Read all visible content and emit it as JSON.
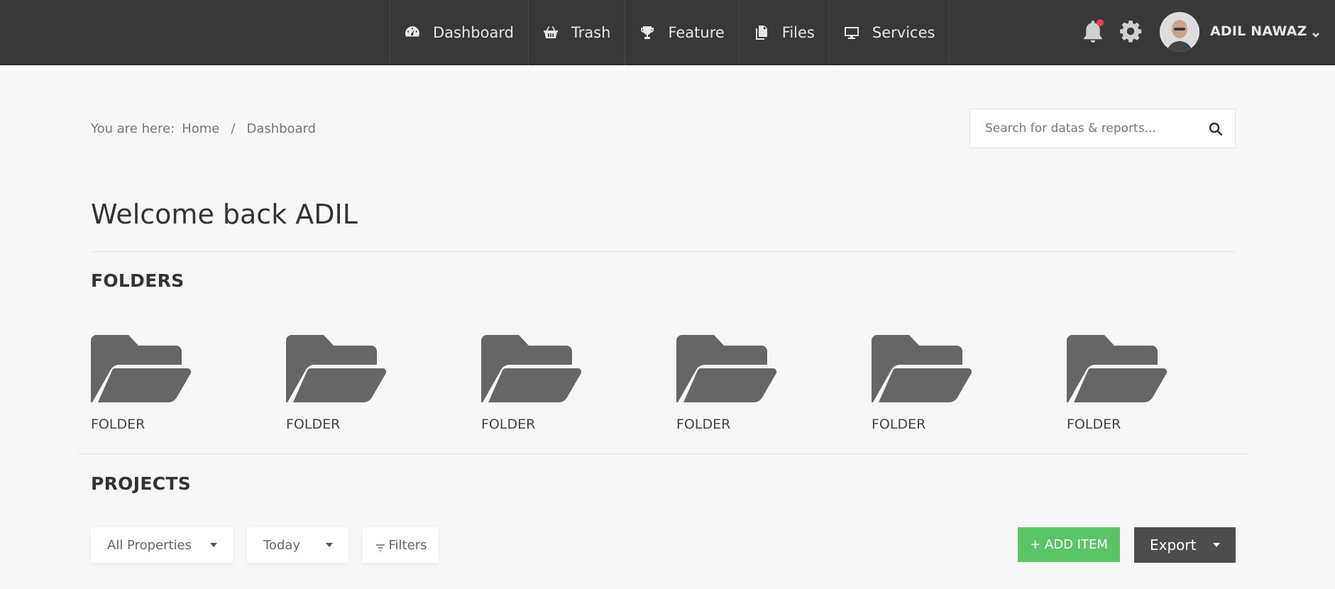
{
  "nav": {
    "items": [
      {
        "label": "Dashboard",
        "icon": "speedometer-icon"
      },
      {
        "label": "Trash",
        "icon": "basket-icon"
      },
      {
        "label": "Feature",
        "icon": "trophy-icon"
      },
      {
        "label": "Files",
        "icon": "files-icon"
      },
      {
        "label": "Services",
        "icon": "monitor-icon"
      }
    ]
  },
  "header": {
    "user_name": "ADIL NAWAZ",
    "notification_dot_color": "#e8414f"
  },
  "breadcrumb": {
    "label": "You are here:",
    "items": [
      "Home",
      "Dashboard"
    ],
    "separator": "/"
  },
  "search": {
    "placeholder": "Search for datas & reports..."
  },
  "welcome": {
    "title": "Welcome back ADIL"
  },
  "folders": {
    "title": "FOLDERS",
    "items": [
      "FOLDER",
      "FOLDER",
      "FOLDER",
      "FOLDER",
      "FOLDER",
      "FOLDER"
    ]
  },
  "projects": {
    "title": "PROJECTS",
    "property_filter": "All Properties",
    "date_filter": "Today",
    "filters_label": "Filters",
    "add_item_label": "+ ADD ITEM",
    "export_label": "Export"
  },
  "colors": {
    "topbar": "#383838",
    "accent_green": "#5bc467",
    "export_dark": "#4d4d4d",
    "folder_gray": "#666666"
  }
}
